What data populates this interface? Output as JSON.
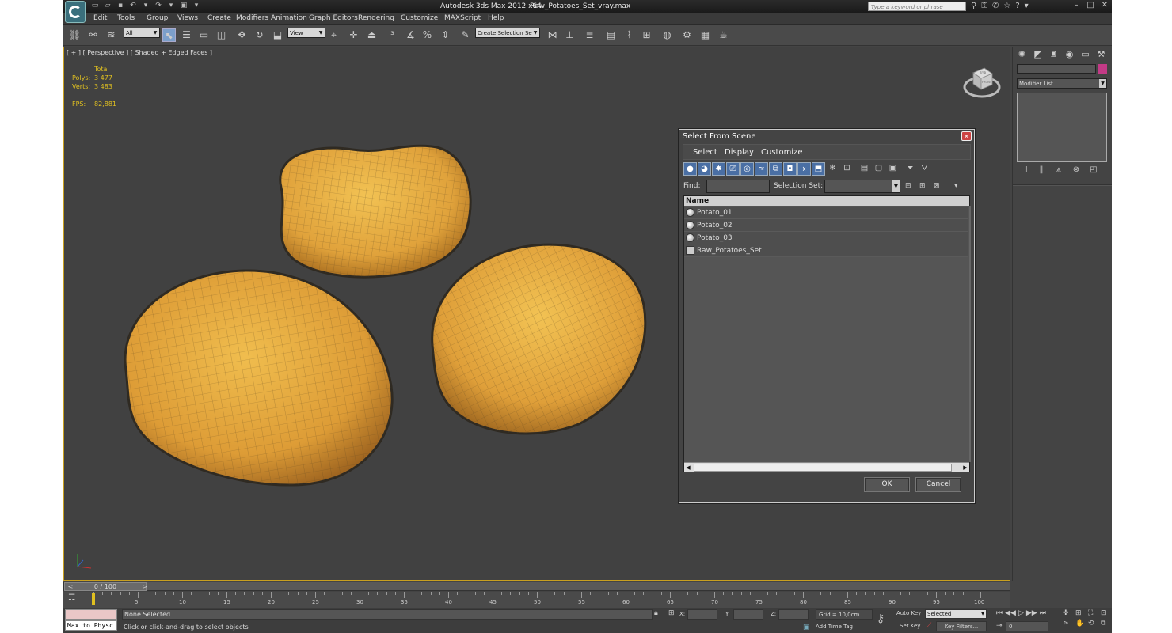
{
  "titlebar": {
    "app": "Autodesk 3ds Max  2012 x64",
    "file": "Raw_Potatoes_Set_vray.max",
    "search_placeholder": "Type a keyword or phrase"
  },
  "menu": [
    "Edit",
    "Tools",
    "Group",
    "Views",
    "Create",
    "Modifiers",
    "Animation",
    "Graph Editors",
    "Rendering",
    "Customize",
    "MAXScript",
    "Help"
  ],
  "toolbar": {
    "filter_value": "All",
    "ref_coord": "View",
    "selection_set": "Create Selection Se"
  },
  "viewport": {
    "label": "[ + ] [ Perspective ] [ Shaded + Edged Faces ]",
    "stats": {
      "header": "Total",
      "polys_label": "Polys:",
      "polys": "3 477",
      "verts_label": "Verts:",
      "verts": "3 483",
      "fps_label": "FPS:",
      "fps": "82,881"
    },
    "cube": {
      "top": "TOP",
      "front": "FRONT"
    }
  },
  "dialog": {
    "title": "Select From Scene",
    "close": "✕",
    "menu": [
      "Select",
      "Display",
      "Customize"
    ],
    "find_label": "Find:",
    "find_value": "",
    "selset_label": "Selection Set:",
    "list_header": "Name",
    "items": [
      {
        "name": "Potato_01"
      },
      {
        "name": "Potato_02"
      },
      {
        "name": "Potato_03"
      },
      {
        "name": "Raw_Potatoes_Set"
      }
    ],
    "ok": "OK",
    "cancel": "Cancel"
  },
  "cmdpanel": {
    "modifier_list": "Modifier List",
    "color": "#c33a86"
  },
  "timeslider": {
    "label": "0 / 100",
    "left": "<",
    ">": ">"
  },
  "track": {
    "ticks": [
      "5",
      "10",
      "15",
      "20",
      "25",
      "30",
      "35",
      "40",
      "45",
      "50",
      "55",
      "60",
      "65",
      "70",
      "75",
      "80",
      "85",
      "90",
      "95",
      "100"
    ]
  },
  "status": {
    "maxscript": "Max to Physc",
    "selection": "None Selected",
    "prompt": "Click or click-and-drag to select objects",
    "x_label": "X:",
    "y_label": "Y:",
    "z_label": "Z:",
    "grid": "Grid = 10,0cm",
    "add_time_tag": "Add Time Tag",
    "auto_key": "Auto Key",
    "set_key": "Set Key",
    "selected": "Selected",
    "key_filters": "Key Filters...",
    "frame": "0"
  }
}
